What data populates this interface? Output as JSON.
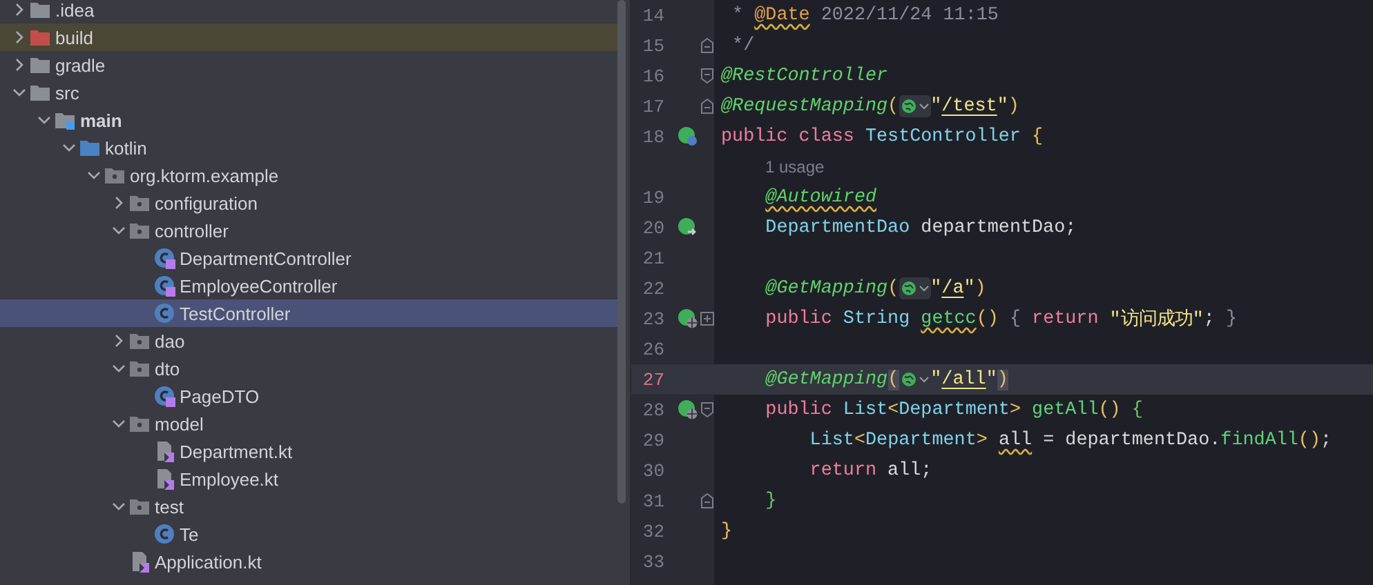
{
  "project_tree": [
    {
      "name": ".idea",
      "kind": "folder",
      "expanded": false,
      "selected": false
    },
    {
      "name": "build",
      "kind": "excluded-folder",
      "expanded": false,
      "selected": false
    },
    {
      "name": "gradle",
      "kind": "folder",
      "expanded": false,
      "selected": false
    },
    {
      "name": "src",
      "kind": "folder",
      "expanded": true,
      "selected": false,
      "children": [
        {
          "name": "main",
          "kind": "module-folder",
          "expanded": true,
          "selected": false,
          "children": [
            {
              "name": "kotlin",
              "kind": "source-root",
              "expanded": true,
              "selected": false,
              "children": [
                {
                  "name": "org.ktorm.example",
                  "kind": "package",
                  "expanded": true,
                  "selected": false,
                  "children": [
                    {
                      "name": "configuration",
                      "kind": "package",
                      "expanded": false,
                      "selected": false
                    },
                    {
                      "name": "controller",
                      "kind": "package",
                      "expanded": true,
                      "selected": false,
                      "children": [
                        {
                          "name": "DepartmentController",
                          "kind": "kotlin-class",
                          "selected": false
                        },
                        {
                          "name": "EmployeeController",
                          "kind": "kotlin-class",
                          "selected": false
                        },
                        {
                          "name": "TestController",
                          "kind": "class",
                          "selected": true
                        }
                      ]
                    },
                    {
                      "name": "dao",
                      "kind": "package",
                      "expanded": false,
                      "selected": false
                    },
                    {
                      "name": "dto",
                      "kind": "package",
                      "expanded": true,
                      "selected": false,
                      "children": [
                        {
                          "name": "PageDTO",
                          "kind": "kotlin-class",
                          "selected": false
                        }
                      ]
                    },
                    {
                      "name": "model",
                      "kind": "package",
                      "expanded": true,
                      "selected": false,
                      "children": [
                        {
                          "name": "Department.kt",
                          "kind": "kotlin-file",
                          "selected": false
                        },
                        {
                          "name": "Employee.kt",
                          "kind": "kotlin-file",
                          "selected": false
                        }
                      ]
                    },
                    {
                      "name": "test",
                      "kind": "package",
                      "expanded": true,
                      "selected": false,
                      "children": [
                        {
                          "name": "Te",
                          "kind": "class",
                          "selected": false
                        }
                      ]
                    },
                    {
                      "name": "Application.kt",
                      "kind": "kotlin-file",
                      "selected": false
                    }
                  ]
                }
              ]
            }
          ]
        }
      ]
    }
  ],
  "editor": {
    "lines": [
      {
        "kind": "code",
        "number": "14",
        "current": false,
        "tokens": [
          {
            "text": " * ",
            "kind": "comment"
          },
          {
            "text": "@Date",
            "kind": "doc-tag",
            "squiggly": true
          },
          {
            "text": " 2022/11/24 11:15",
            "kind": "comment"
          }
        ]
      },
      {
        "kind": "code",
        "number": "15",
        "current": false,
        "fold": {
          "kind": "end"
        },
        "tokens": [
          {
            "text": " */",
            "kind": "comment"
          }
        ]
      },
      {
        "kind": "code",
        "number": "16",
        "current": false,
        "fold": {
          "kind": "start"
        },
        "tokens": [
          {
            "text": "@RestController",
            "kind": "annotation"
          }
        ]
      },
      {
        "kind": "code",
        "number": "17",
        "current": false,
        "fold": {
          "kind": "end"
        },
        "tokens": [
          {
            "text": "@RequestMapping",
            "kind": "annotation"
          },
          {
            "text": "(",
            "kind": "paren"
          },
          {
            "kind": "url-inlay"
          },
          {
            "text": "\"",
            "kind": "string"
          },
          {
            "text": "/test",
            "kind": "string",
            "underlined": true
          },
          {
            "text": "\"",
            "kind": "string"
          },
          {
            "text": ")",
            "kind": "paren"
          }
        ]
      },
      {
        "kind": "code",
        "number": "18",
        "current": false,
        "marker": {
          "kind": "bean"
        },
        "tokens": [
          {
            "text": "public class ",
            "kind": "keyword"
          },
          {
            "text": "TestController ",
            "kind": "type"
          },
          {
            "text": "{",
            "kind": "paren"
          }
        ]
      },
      {
        "kind": "hint",
        "text": "1 usage"
      },
      {
        "kind": "code",
        "number": "19",
        "current": false,
        "tokens": [
          {
            "text": "    @Autowired",
            "kind": "annotation",
            "squiggly": true
          }
        ]
      },
      {
        "kind": "code",
        "number": "20",
        "current": false,
        "marker": {
          "kind": "bean-arrow"
        },
        "tokens": [
          {
            "text": "    DepartmentDao ",
            "kind": "type"
          },
          {
            "text": "departmentDao;",
            "kind": "plain"
          }
        ]
      },
      {
        "kind": "code",
        "number": "21",
        "current": false
      },
      {
        "kind": "code",
        "number": "22",
        "current": false,
        "tokens": [
          {
            "text": "    @GetMapping",
            "kind": "annotation"
          },
          {
            "text": "(",
            "kind": "paren"
          },
          {
            "kind": "url-inlay"
          },
          {
            "text": "\"",
            "kind": "string"
          },
          {
            "text": "/a",
            "kind": "string",
            "underlined": true
          },
          {
            "text": "\"",
            "kind": "string"
          },
          {
            "text": ")",
            "kind": "paren"
          }
        ]
      },
      {
        "kind": "code",
        "number": "23",
        "current": false,
        "marker": {
          "kind": "bean-globe"
        },
        "fold": {
          "kind": "collapsed"
        },
        "tokens": [
          {
            "text": "    public ",
            "kind": "keyword"
          },
          {
            "text": "String ",
            "kind": "type"
          },
          {
            "text": "getcc",
            "kind": "method",
            "squiggly": true
          },
          {
            "text": "() ",
            "kind": "paren"
          },
          {
            "text": "{ ",
            "kind": "folded"
          },
          {
            "text": "return ",
            "kind": "keyword"
          },
          {
            "text": "\"访问成功\"",
            "kind": "string"
          },
          {
            "text": "; ",
            "kind": "plain"
          },
          {
            "text": "}",
            "kind": "folded"
          }
        ]
      },
      {
        "kind": "code",
        "number": "26",
        "current": false
      },
      {
        "kind": "code",
        "number": "27",
        "current": true,
        "tokens": [
          {
            "text": "    @GetMapping",
            "kind": "annotation"
          },
          {
            "text": "(",
            "kind": "paren-match"
          },
          {
            "kind": "url-inlay"
          },
          {
            "text": "\"",
            "kind": "string"
          },
          {
            "text": "/all",
            "kind": "string",
            "underlined": true
          },
          {
            "text": "\"",
            "kind": "string"
          },
          {
            "text": ")",
            "kind": "paren-match"
          }
        ]
      },
      {
        "kind": "code",
        "number": "28",
        "current": false,
        "marker": {
          "kind": "bean-globe"
        },
        "fold": {
          "kind": "start"
        },
        "tokens": [
          {
            "text": "    public ",
            "kind": "keyword"
          },
          {
            "text": "List",
            "kind": "type"
          },
          {
            "text": "<",
            "kind": "paren"
          },
          {
            "text": "Department",
            "kind": "type"
          },
          {
            "text": "> ",
            "kind": "paren"
          },
          {
            "text": "getAll",
            "kind": "method"
          },
          {
            "text": "() ",
            "kind": "paren"
          },
          {
            "text": "{",
            "kind": "block"
          }
        ]
      },
      {
        "kind": "code",
        "number": "29",
        "current": false,
        "tokens": [
          {
            "text": "        List",
            "kind": "type"
          },
          {
            "text": "<",
            "kind": "paren"
          },
          {
            "text": "Department",
            "kind": "type"
          },
          {
            "text": "> ",
            "kind": "paren"
          },
          {
            "text": "all",
            "kind": "plain",
            "squiggly": true
          },
          {
            "text": " = departmentDao.",
            "kind": "plain"
          },
          {
            "text": "findAll",
            "kind": "method"
          },
          {
            "text": "()",
            "kind": "paren"
          },
          {
            "text": ";",
            "kind": "plain"
          }
        ]
      },
      {
        "kind": "code",
        "number": "30",
        "current": false,
        "tokens": [
          {
            "text": "        return ",
            "kind": "keyword"
          },
          {
            "text": "all;",
            "kind": "plain"
          }
        ]
      },
      {
        "kind": "code",
        "number": "31",
        "current": false,
        "fold": {
          "kind": "end"
        },
        "tokens": [
          {
            "text": "    }",
            "kind": "block"
          }
        ]
      },
      {
        "kind": "code",
        "number": "32",
        "current": false,
        "tokens": [
          {
            "text": "}",
            "kind": "paren"
          }
        ]
      },
      {
        "kind": "code",
        "number": "33",
        "current": false
      }
    ]
  }
}
